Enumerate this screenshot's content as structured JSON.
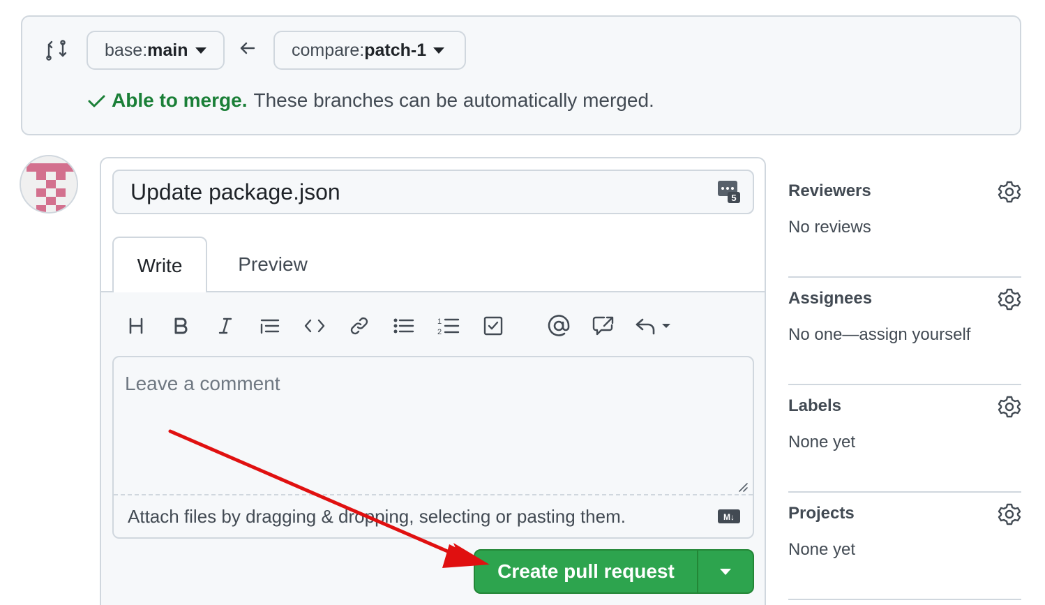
{
  "compare": {
    "base_prefix": "base: ",
    "base_branch": "main",
    "compare_prefix": "compare: ",
    "compare_branch": "patch-1",
    "merge_ok": "Able to merge.",
    "merge_msg": "These branches can be automatically merged."
  },
  "form": {
    "title_value": "Update package.json",
    "saved_replies_count": "5",
    "tabs": [
      {
        "label": "Write",
        "active": true
      },
      {
        "label": "Preview",
        "active": false
      }
    ],
    "toolbar_icons": [
      "heading-icon",
      "bold-icon",
      "italic-icon",
      "quote-icon",
      "code-icon",
      "link-icon",
      "unordered-list-icon",
      "ordered-list-icon",
      "task-list-icon",
      "mention-icon",
      "cross-reference-icon",
      "reply-icon"
    ],
    "comment_placeholder": "Leave a comment",
    "attach_text": "Attach files by dragging & dropping, selecting or pasting them.",
    "markdown_badge": "M↓",
    "submit_label": "Create pull request"
  },
  "sidebar": {
    "sections": [
      {
        "title": "Reviewers",
        "value": "No reviews"
      },
      {
        "title": "Assignees",
        "value": "No one—assign yourself"
      },
      {
        "title": "Labels",
        "value": "None yet"
      },
      {
        "title": "Projects",
        "value": "None yet"
      }
    ]
  },
  "colors": {
    "accent_green": "#2da44e",
    "merge_green": "#1a7f37",
    "annotation_red": "#e01010",
    "border": "#d0d7de"
  }
}
